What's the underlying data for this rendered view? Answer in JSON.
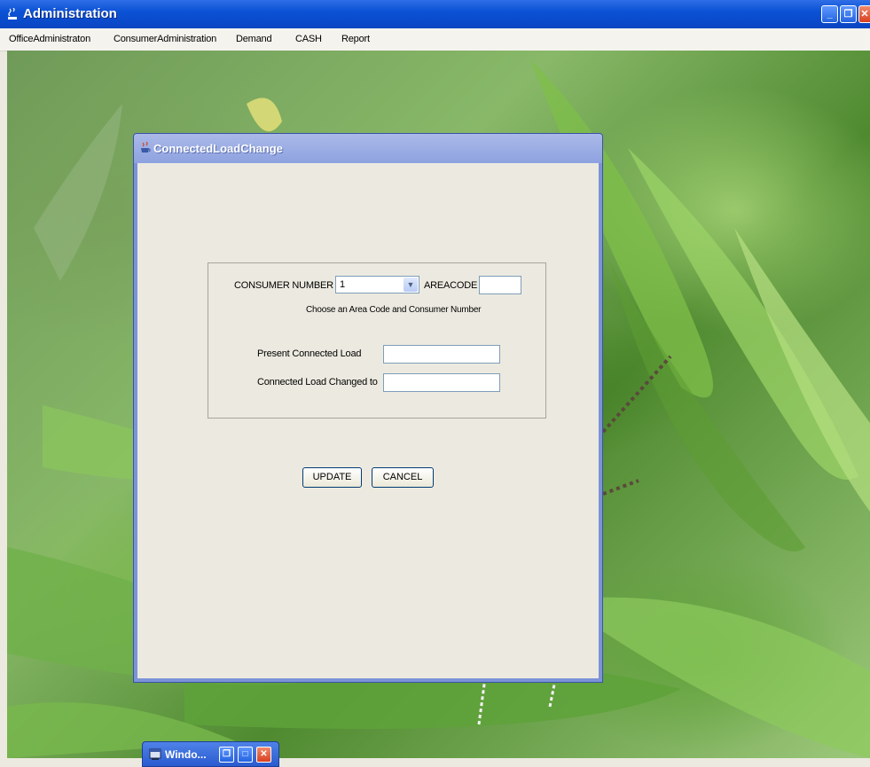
{
  "window": {
    "title": "Administration",
    "minimize_label": "_",
    "restore_label": "❐",
    "close_label": "✕"
  },
  "menubar": {
    "items": [
      "OfficeAdministraton",
      "ConsumerAdministration",
      "Demand",
      "CASH",
      "Report"
    ]
  },
  "dialog": {
    "title": "ConnectedLoadChange",
    "consumer_number_label": "CONSUMER NUMBER",
    "consumer_number_value": "1",
    "areacode_label": "AREACODE",
    "areacode_value": "",
    "hint": "Choose an Area Code and Consumer Number",
    "present_load_label": "Present Connected Load",
    "present_load_value": "",
    "changed_load_label": "Connected Load Changed to",
    "changed_load_value": "",
    "update_label": "UPDATE",
    "cancel_label": "CANCEL"
  },
  "minimized_frame": {
    "title": "Windo...",
    "restore_label": "❐",
    "maximize_label": "□",
    "close_label": "✕"
  },
  "icons": {
    "window_icon": "java-cup-icon",
    "dialog_icon": "java-cup-icon",
    "minimized_icon": "window-icon",
    "combo_arrow": "chevron-down-icon"
  },
  "colors": {
    "titlebar": "#0b52d6",
    "dialog_title": "#8ea2e0",
    "panel_bg": "#eceae0"
  }
}
